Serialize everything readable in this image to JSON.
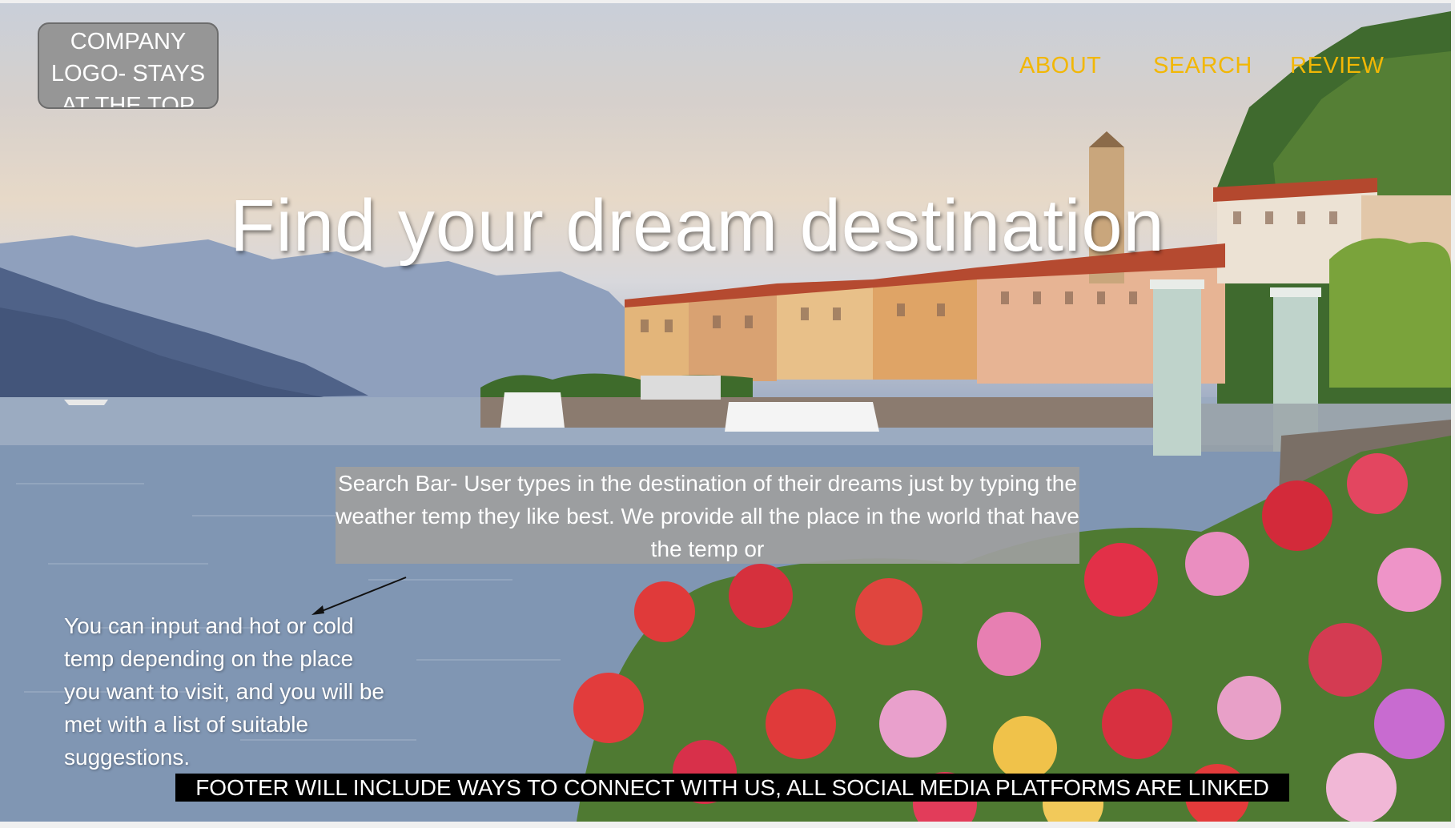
{
  "header": {
    "logo_text": "COMPANY LOGO- STAYS AT THE TOP",
    "nav": [
      {
        "label": "ABOUT"
      },
      {
        "label": "SEARCH"
      },
      {
        "label": "REVIEW"
      }
    ]
  },
  "hero": {
    "title": "Find your dream destination"
  },
  "search_bar": {
    "text": "Search Bar- User types in the destination of their dreams just by typing the weather temp they like best. We provide all the place in the world that have the temp or"
  },
  "annotation": {
    "text": "You can input and hot or cold temp depending on the place you want to visit, and you will be met with a list of suitable suggestions."
  },
  "footer": {
    "text": "FOOTER WILL INCLUDE WAYS TO CONNECT WITH US, ALL SOCIAL MEDIA PLATFORMS ARE LINKED"
  },
  "colors": {
    "nav": "#f2b705",
    "logo_background": "#969696",
    "search_background": "#9e9e9e",
    "footer_background": "#000000",
    "text": "#ffffff"
  }
}
